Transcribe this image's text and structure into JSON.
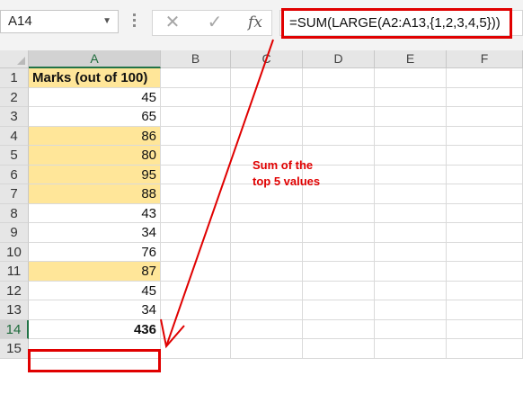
{
  "name_box": {
    "value": "A14",
    "dropdown_icon": "chevron-down-icon"
  },
  "formula_bar": {
    "cancel_icon": "close-icon",
    "enter_icon": "checkmark-icon",
    "fx_label": "fx",
    "formula": "=SUM(LARGE(A2:A13,{1,2,3,4,5}))"
  },
  "columns": [
    "A",
    "B",
    "C",
    "D",
    "E",
    "F"
  ],
  "selected_column": "A",
  "rows": [
    {
      "num": "1",
      "a": "Marks (out of 100)"
    },
    {
      "num": "2",
      "a": "45"
    },
    {
      "num": "3",
      "a": "65"
    },
    {
      "num": "4",
      "a": "86"
    },
    {
      "num": "5",
      "a": "80"
    },
    {
      "num": "6",
      "a": "95"
    },
    {
      "num": "7",
      "a": "88"
    },
    {
      "num": "8",
      "a": "43"
    },
    {
      "num": "9",
      "a": "34"
    },
    {
      "num": "10",
      "a": "76"
    },
    {
      "num": "11",
      "a": "87"
    },
    {
      "num": "12",
      "a": "45"
    },
    {
      "num": "13",
      "a": "34"
    },
    {
      "num": "14",
      "a": "436"
    },
    {
      "num": "15",
      "a": ""
    }
  ],
  "highlight_fill": "#ffe699",
  "annotation": {
    "line1": "Sum of the",
    "line2": "top 5 values",
    "color": "#e00000"
  }
}
